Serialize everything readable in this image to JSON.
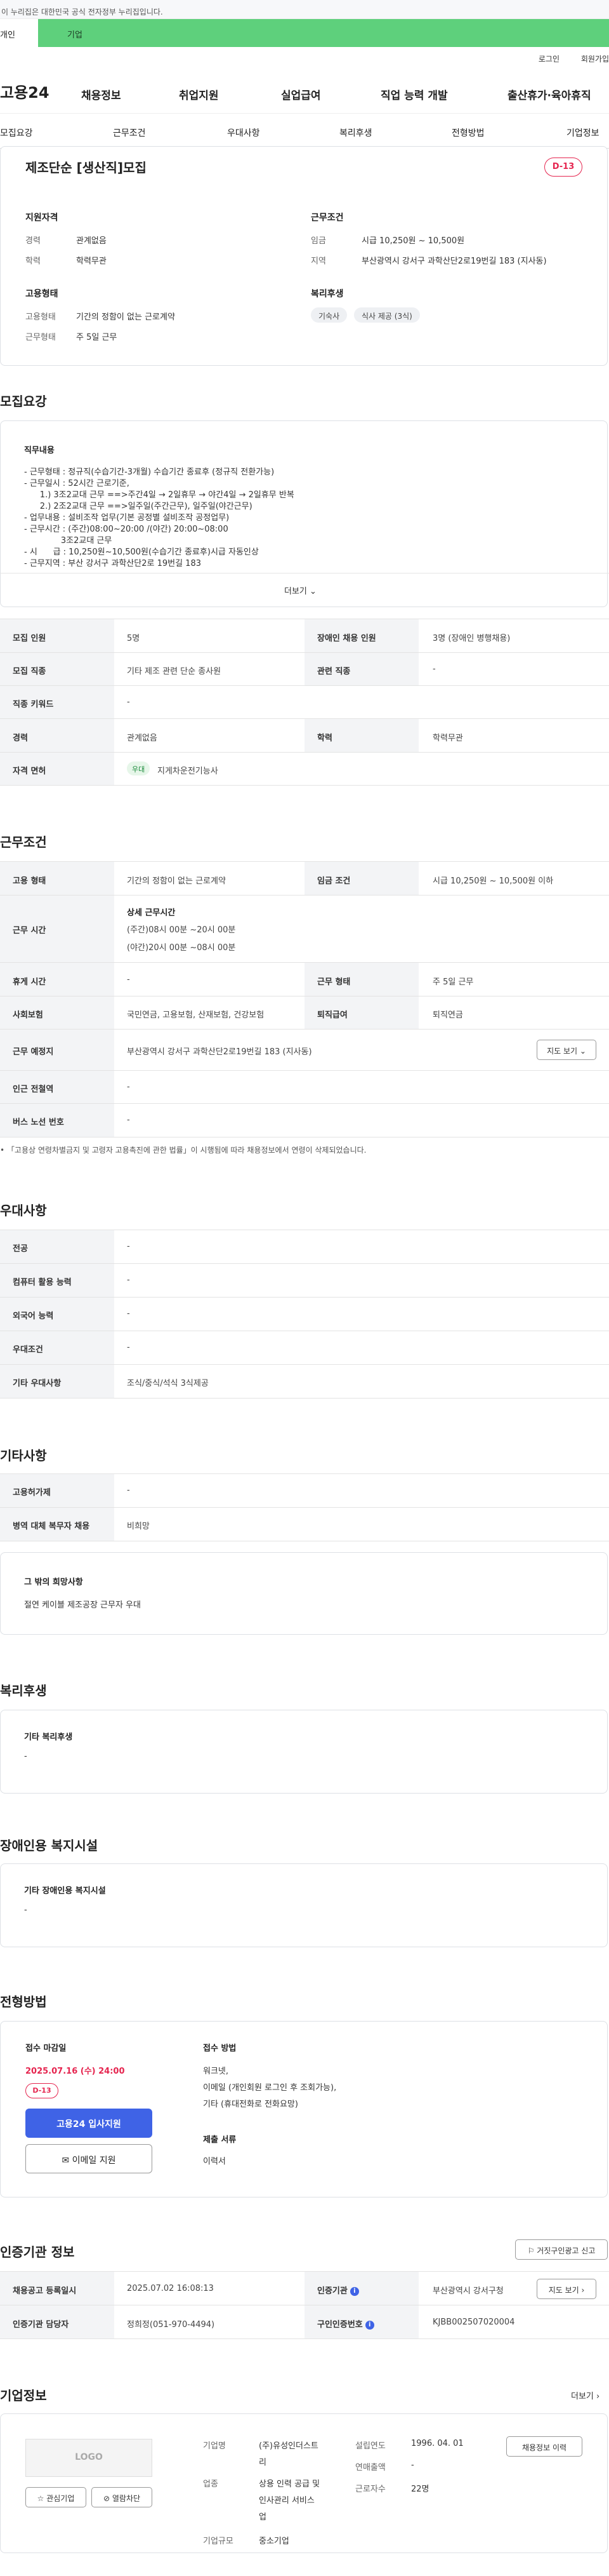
{
  "top": {
    "gov_banner": "이 누리집은 대한민국 공식 전자정부 누리집입니다.",
    "tab_left": "개인",
    "tab_right": "기업",
    "login": "로그인",
    "join": "회원가입"
  },
  "gnb": {
    "logo": "고용24",
    "menu": [
      "채용정보",
      "취업지원",
      "실업급여",
      "직업 능력 개발",
      "출산휴가·육아휴직"
    ]
  },
  "subnav": [
    "모집요강",
    "근무조건",
    "우대사항",
    "복리후생",
    "전형방법",
    "기업정보"
  ],
  "summary": {
    "title": "제조단순 [생산직]모집",
    "dday": "D-13",
    "qual_title": "지원자격",
    "career_k": "경력",
    "career_v": "관계없음",
    "edu_k": "학력",
    "edu_v": "학력무관",
    "cond_title": "근무조건",
    "wage_k": "임금",
    "wage_v": "시급 10,250원 ~ 10,500원",
    "area_k": "지역",
    "area_v": "부산광역시 강서구 과학산단2로19번길 183 (지사동)",
    "emp_title": "고용형태",
    "emptype_k": "고용형태",
    "emptype_v": "기간의 정함이 없는 근로계약",
    "worktype_k": "근무형태",
    "worktype_v": "주 5일 근무",
    "welfare_title": "복리후생",
    "chips": [
      "기숙사",
      "식사 제공 (3식)"
    ]
  },
  "recruit": {
    "title": "모집요강",
    "desc_title": "직무내용",
    "desc_lines": [
      "- 근무형태 : 정규직(수습기간-3개월) 수습기간 종료후 (정규직 전환가능)",
      "- 근무일시 : 52시간 근로기준,",
      "      1.) 3조2교대 근무 ==>주간4일 → 2일휴무 → 야간4일 → 2일휴무 반복",
      "      2.) 2조2교대 근무 ==>일주일(주간근무), 일주일(야간근무)",
      "- 업무내용 : 설비조작 업무(기본 공정별 설비조작 공정업무)",
      "- 근무시간 : (주간)08:00~20:00 /(야간) 20:00~08:00",
      "              3조2교대 근무",
      "- 시      급 : 10,250원~10,500원(수습기간 종료후)시급 자동인상",
      "- 근무지역 : 부산 강서구 과학산단2로 19번길 183"
    ],
    "more": "더보기",
    "table": {
      "r1_k1": "모집 인원",
      "r1_v1": "5명",
      "r1_k2": "장애인 채용 인원",
      "r1_v2": "3명 (장애인 병행채용)",
      "r2_k1": "모집 직종",
      "r2_v1": "기타 제조 관련 단순 종사원",
      "r2_k2": "관련 직종",
      "r2_v2": "-",
      "r3_k1": "직종 키워드",
      "r3_v1": "-",
      "r4_k1": "경력",
      "r4_v1": "관계없음",
      "r4_k2": "학력",
      "r4_v2": "학력무관",
      "r5_k1": "자격 면허",
      "r5_badge": "우대",
      "r5_v1": "지게차운전기능사"
    }
  },
  "work": {
    "title": "근무조건",
    "emp_k": "고용 형태",
    "emp_v": "기간의 정함이 없는 근로계약",
    "wage_k": "임금 조건",
    "wage_v": "시급 10,250원 ~ 10,500원 이하",
    "time_k": "근무 시간",
    "time_title": "상세 근무시간",
    "time_v1": "(주간)08시 00분 ~20시 00분",
    "time_v2": "(야간)20시 00분 ~08시 00분",
    "rest_k": "휴게 시간",
    "rest_v": "-",
    "form_k": "근무 형태",
    "form_v": "주 5일 근무",
    "ins_k": "사회보험",
    "ins_v": "국민연금, 고용보험, 산재보험, 건강보험",
    "ret_k": "퇴직급여",
    "ret_v": "퇴직연금",
    "place_k": "근무 예정지",
    "place_v": "부산광역시 강서구 과학산단2로19번길 183 (지사동)",
    "map_btn": "지도 보기",
    "station_k": "인근 전철역",
    "station_v": "-",
    "bus_k": "버스 노선 번호",
    "bus_v": "-",
    "note": "「고용상 연령차별금지 및 고령자 고용촉진에 관한 법률」이 시행됨에 따라 채용정보에서 연령이 삭제되었습니다."
  },
  "pref": {
    "title": "우대사항",
    "rows": [
      {
        "k": "전공",
        "v": "-"
      },
      {
        "k": "컴퓨터 활용 능력",
        "v": "-"
      },
      {
        "k": "외국어 능력",
        "v": "-"
      },
      {
        "k": "우대조건",
        "v": "-"
      },
      {
        "k": "기타 우대사항",
        "v": "조식/중식/석식 3식제공"
      }
    ]
  },
  "etc": {
    "title": "기타사항",
    "r1_k": "고용허가제",
    "r1_v": "-",
    "r2_k": "병역 대체 복무자 채용",
    "r2_v": "비희망",
    "box_title": "그 밖의 희망사항",
    "box_v": "절연 케이블 제조공장 근무자 우대"
  },
  "welfare": {
    "title": "복리후생",
    "box_title": "기타 복리후생",
    "box_v": "-"
  },
  "disabled": {
    "title": "장애인용 복지시설",
    "box_title": "기타 장애인용 복지시설",
    "box_v": "-"
  },
  "screening": {
    "title": "전형방법",
    "deadline_k": "접수 마감일",
    "deadline_v": "2025.07.16 (수) 24:00",
    "dday": "D-13",
    "apply_btn": "고용24 입사지원",
    "email_btn": "이메일 지원",
    "method_k": "접수 방법",
    "method_v1": "워크넷,",
    "method_v2": "이메일 (개인회원 로그인 후 조회가능),",
    "method_v3": "기타 (휴대전화로 전화요망)",
    "docs_k": "제출 서류",
    "docs_v": "이력서"
  },
  "cert": {
    "title": "인증기관 정보",
    "report_btn": "거짓구인광고 신고",
    "reg_k": "채용공고 등록일시",
    "reg_v": "2025.07.02 16:08:13",
    "org_k": "인증기관",
    "org_v": "부산광역시 강서구청",
    "map_btn": "지도 보기",
    "mgr_k": "인증기관 담당자",
    "mgr_v": "정희정(051-970-4494)",
    "num_k": "구인인증번호",
    "num_v": "KJBB002507020004"
  },
  "company": {
    "title": "기업정보",
    "more": "더보기",
    "logo": "LOGO",
    "fav_btn": "관심기업",
    "block_btn": "열람차단",
    "name_k": "기업명",
    "name_v1": "(주)유성인더스트",
    "name_v2": "리",
    "ind_k": "업종",
    "ind_v1": "상용 인력 공급 및",
    "ind_v2": "인사관리 서비스",
    "ind_v3": "업",
    "size_k": "기업규모",
    "size_v": "중소기업",
    "est_k": "설립연도",
    "est_v": "1996. 04. 01",
    "sales_k": "연매출액",
    "sales_v": "-",
    "emp_k": "근로자수",
    "emp_v": "22명",
    "jobs_btn": "채용정보 이력"
  }
}
